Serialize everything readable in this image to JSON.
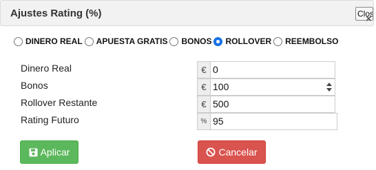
{
  "header": {
    "title": "Ajustes Rating (%)",
    "close_label": "Close",
    "close_x": "×"
  },
  "radios": [
    {
      "label": "DINERO REAL",
      "checked": false
    },
    {
      "label": "APUESTA GRATIS",
      "checked": false
    },
    {
      "label": "BONOS",
      "checked": false
    },
    {
      "label": "ROLLOVER",
      "checked": true
    },
    {
      "label": "REEMBOLSO",
      "checked": false
    }
  ],
  "fields": [
    {
      "label": "Dinero Real",
      "addon": "€",
      "value": "0"
    },
    {
      "label": "Bonos",
      "addon": "€",
      "value": "100"
    },
    {
      "label": "Rollover Restante",
      "addon": "€",
      "value": "500"
    },
    {
      "label": "Rating Futuro",
      "addon": "%",
      "value": "95"
    }
  ],
  "buttons": {
    "apply_label": "Aplicar",
    "cancel_label": "Cancelar"
  },
  "colors": {
    "apply": "#5cb85c",
    "cancel": "#d9534f",
    "radio_checked": "#1a73e8"
  },
  "icons": {
    "apply": "floppy-disk-icon",
    "cancel": "ban-icon",
    "spinner": "spinner-arrows-icon"
  }
}
